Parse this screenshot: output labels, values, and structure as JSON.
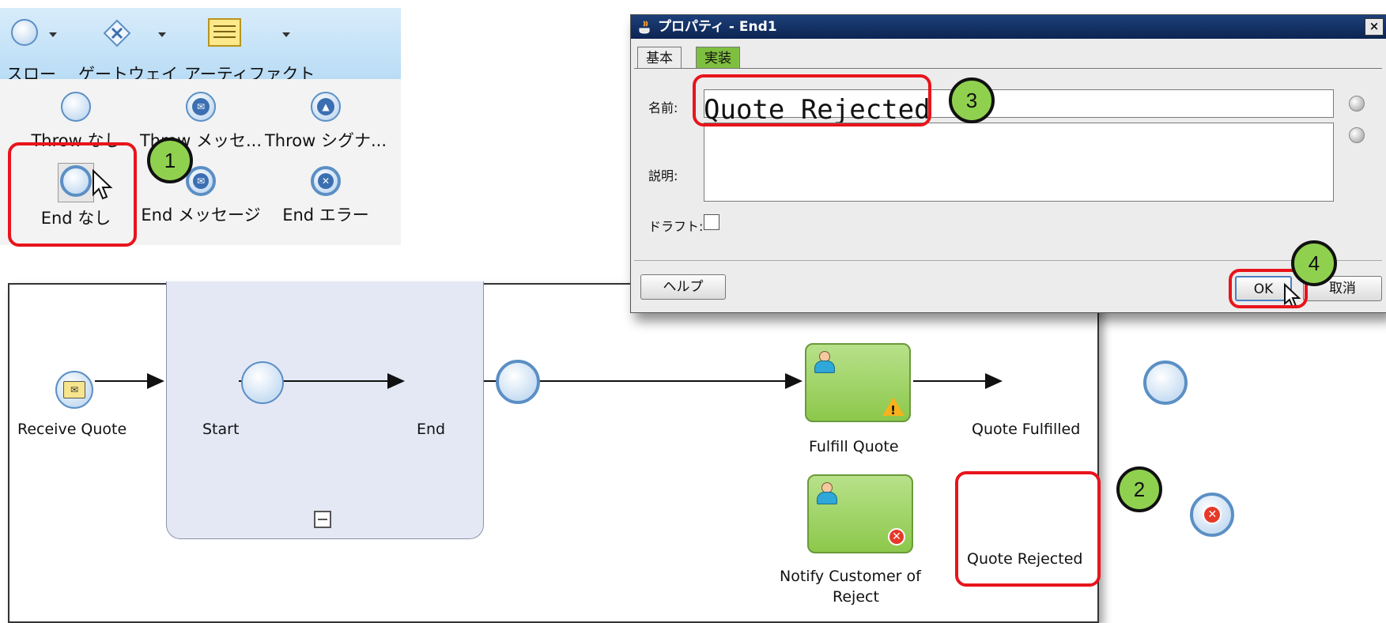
{
  "palette": {
    "tabs": [
      "スロー",
      "ゲートウェイ",
      "アーティファクト"
    ],
    "items": [
      {
        "label": "Throw なし"
      },
      {
        "label": "Throw メッセ..."
      },
      {
        "label": "Throw シグナ..."
      },
      {
        "label": "End なし"
      },
      {
        "label": "End メッセージ"
      },
      {
        "label": "End エラー"
      }
    ]
  },
  "callouts": [
    "1",
    "2",
    "3",
    "4"
  ],
  "diagram": {
    "nodes": {
      "receive_quote": "Receive Quote",
      "start": "Start",
      "end": "End",
      "fulfill_quote": "Fulfill Quote",
      "quote_fulfilled": "Quote Fulfilled",
      "notify_customer_line1": "Notify Customer of",
      "notify_customer_line2": "Reject",
      "quote_rejected": "Quote Rejected"
    }
  },
  "dialog": {
    "title": "プロパティ - End1",
    "close_label": "×",
    "tabs": [
      "基本",
      "実装"
    ],
    "name_label": "名前:",
    "name_value": "Quote Rejected",
    "description_label": "説明:",
    "description_value": "",
    "draft_label": "ドラフト:",
    "help_button": "ヘルプ",
    "ok_button": "OK",
    "cancel_button": "取消"
  }
}
